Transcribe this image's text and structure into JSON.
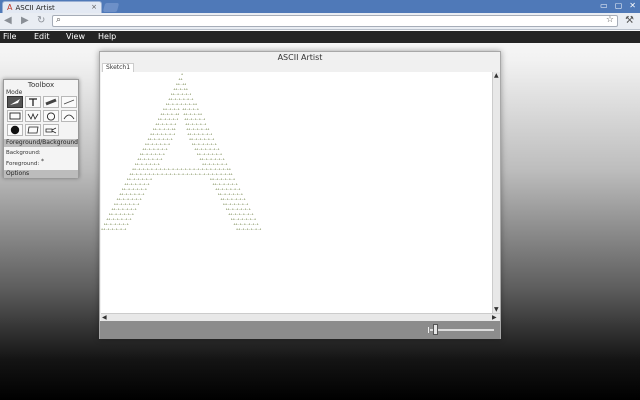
{
  "browser": {
    "tab_title": "ASCII Artist",
    "tab_close": "×",
    "favicon_glyph": "A",
    "window_controls": [
      "▭",
      "▢",
      "✕"
    ]
  },
  "menubar": {
    "items": [
      "File",
      "Edit",
      "View",
      "Help"
    ]
  },
  "window": {
    "title": "ASCII Artist",
    "tab_label": "Sketch1"
  },
  "toolbox": {
    "title": "Toolbox",
    "mode_label": "Mode",
    "tools": [
      {
        "name": "freehand",
        "icon": "pencil-icon",
        "active": true
      },
      {
        "name": "text",
        "icon": "text-icon",
        "active": false
      },
      {
        "name": "brush",
        "icon": "brush-icon",
        "active": false
      },
      {
        "name": "line",
        "icon": "line-icon",
        "active": false
      },
      {
        "name": "rectangle",
        "icon": "rectangle-icon",
        "active": false
      },
      {
        "name": "zigzag",
        "icon": "zigzag-icon",
        "active": false
      },
      {
        "name": "ellipse",
        "icon": "ellipse-icon",
        "active": false
      },
      {
        "name": "curve",
        "icon": "curve-icon",
        "active": false
      },
      {
        "name": "fill",
        "icon": "fill-circle-icon",
        "active": false
      },
      {
        "name": "eraser",
        "icon": "eraser-icon",
        "active": false
      },
      {
        "name": "stamp",
        "icon": "stamp-icon",
        "active": false
      }
    ],
    "fg_bg_header": "Foreground/Background",
    "background_label": "Background:",
    "foreground_label": "Foreground:",
    "foreground_char": "*",
    "options_header": "Options"
  },
  "canvas": {
    "art_char": "+",
    "bar_char": "-",
    "art_color": "#5a6e2a"
  },
  "zoom": {
    "level": 0.05
  },
  "colors": {
    "tab_strip": "#4f79b8",
    "menubar": "#242424",
    "statusbar": "#8c8c8c"
  }
}
